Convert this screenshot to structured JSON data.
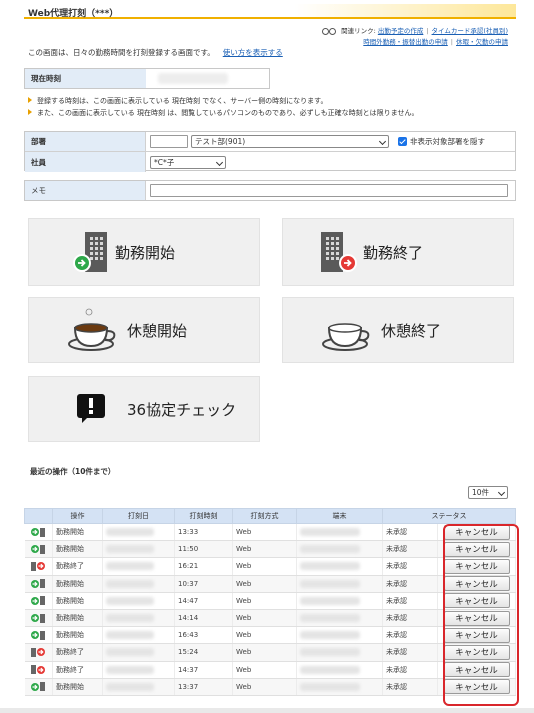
{
  "page": {
    "title": "Web代理打刻（***）"
  },
  "links": {
    "label": "関連リンク:",
    "items": [
      "出勤予定の作成",
      "タイムカード承認(社員別)",
      "時間外勤務・振替出勤の申請",
      "休暇・欠勤の申請"
    ]
  },
  "intro": {
    "text": "この画面は、日々の勤務時間を打刻登録する画面です。",
    "help_link": "使い方を表示する"
  },
  "current_time": {
    "label": "現在時刻"
  },
  "notes": [
    "登録する時刻は、この画面に表示している 現在時刻 でなく、サーバー側の時刻になります。",
    "また、この画面に表示している 現在時刻 は、閲覧しているパソコンのものであり、必ずしも正確な時刻とは限りません。"
  ],
  "form": {
    "dept_label": "部署",
    "dept_code": "",
    "dept_select": "テスト部(901)",
    "hide_checkbox_label": "非表示対象部署を隠す",
    "hide_checked": true,
    "employee_label": "社員",
    "employee_select": "*C*子",
    "memo_label": "メモ",
    "memo_value": ""
  },
  "actions": {
    "work_start": "勤務開始",
    "work_end": "勤務終了",
    "break_start": "休憩開始",
    "break_end": "休憩終了",
    "check36": "36協定チェック"
  },
  "recent": {
    "title": "最近の操作（10件まで）",
    "count_select": "10件",
    "headers": [
      "操作",
      "打刻日",
      "打刻時刻",
      "打刻方式",
      "端末",
      "ステータス"
    ],
    "rows": [
      {
        "icon": "start",
        "op": "勤務開始",
        "time": "13:33",
        "method": "Web",
        "status": "未承認",
        "btn": "キャンセル"
      },
      {
        "icon": "start",
        "op": "勤務開始",
        "time": "11:50",
        "method": "Web",
        "status": "未承認",
        "btn": "キャンセル"
      },
      {
        "icon": "end",
        "op": "勤務終了",
        "time": "16:21",
        "method": "Web",
        "status": "未承認",
        "btn": "キャンセル"
      },
      {
        "icon": "start",
        "op": "勤務開始",
        "time": "10:37",
        "method": "Web",
        "status": "未承認",
        "btn": "キャンセル"
      },
      {
        "icon": "start",
        "op": "勤務開始",
        "time": "14:47",
        "method": "Web",
        "status": "未承認",
        "btn": "キャンセル"
      },
      {
        "icon": "start",
        "op": "勤務開始",
        "time": "14:14",
        "method": "Web",
        "status": "未承認",
        "btn": "キャンセル"
      },
      {
        "icon": "start",
        "op": "勤務開始",
        "time": "16:43",
        "method": "Web",
        "status": "未承認",
        "btn": "キャンセル"
      },
      {
        "icon": "end",
        "op": "勤務終了",
        "time": "15:24",
        "method": "Web",
        "status": "未承認",
        "btn": "キャンセル"
      },
      {
        "icon": "end",
        "op": "勤務終了",
        "time": "14:37",
        "method": "Web",
        "status": "未承認",
        "btn": "キャンセル"
      },
      {
        "icon": "start",
        "op": "勤務開始",
        "time": "13:37",
        "method": "Web",
        "status": "未承認",
        "btn": "キャンセル"
      }
    ]
  },
  "colors": {
    "accent": "#f0b000",
    "start_green": "#2ea84a",
    "end_red": "#e53935",
    "status_red": "#d81b1b",
    "label_bg": "#e2ecf7"
  }
}
